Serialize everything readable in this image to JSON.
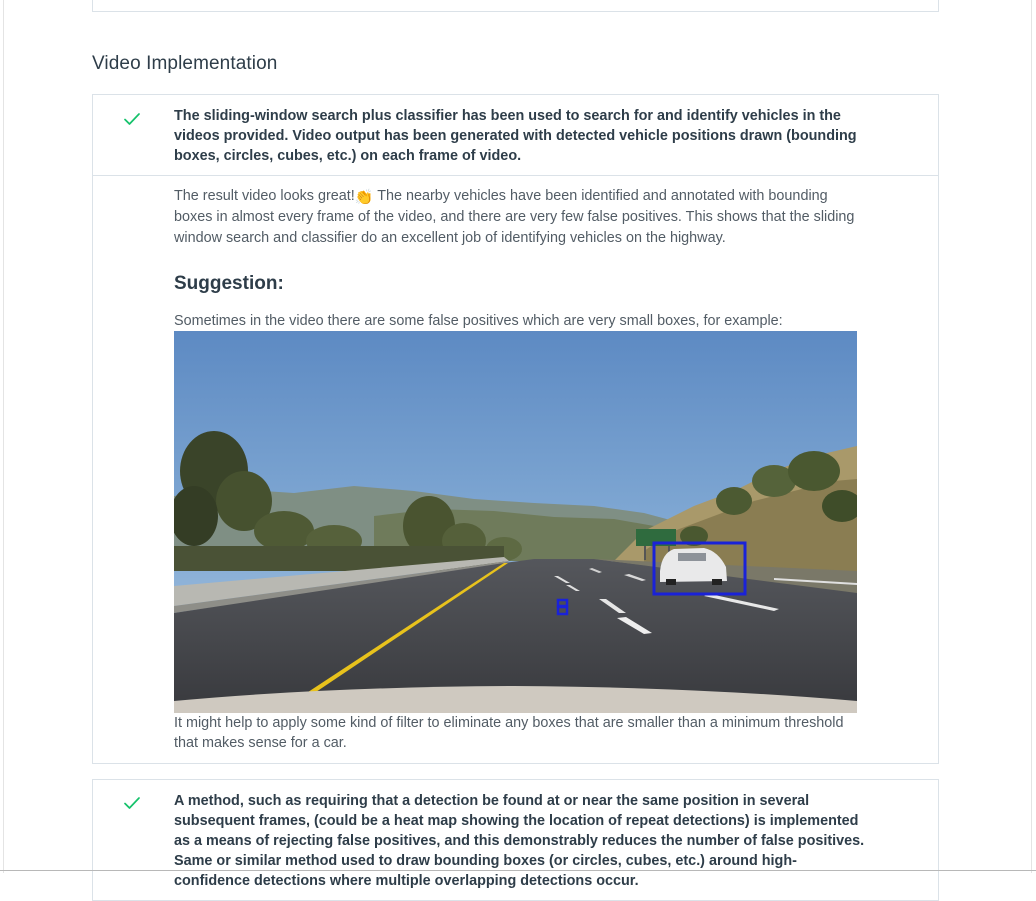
{
  "section": {
    "title": "Video Implementation"
  },
  "rubric_items": [
    {
      "status_icon": "checkmark-icon",
      "criteria": "The sliding-window search plus classifier has been used to search for and identify vehicles in the videos provided. Video output has been generated with detected vehicle positions drawn (bounding boxes, circles, cubes, etc.) on each frame of video.",
      "review": {
        "intro_part1": "The result video looks great!",
        "emoji": "👏",
        "intro_part2": " The nearby vehicles have been identified and annotated with bounding boxes in almost every frame of the video, and there are very few false positives. This shows that the sliding window search and classifier do an excellent job of identifying vehicles on the highway.",
        "suggestion_heading": "Suggestion:",
        "suggestion_text": "Sometimes in the video there are some false positives which are very small boxes, for example:",
        "image_name": "highway-frame-with-detections",
        "followup": "It might help to apply some kind of filter to eliminate any boxes that are smaller than a minimum threshold that makes sense for a car."
      }
    },
    {
      "status_icon": "checkmark-icon",
      "criteria": "A method, such as requiring that a detection be found at or near the same position in several subsequent frames, (could be a heat map showing the location of repeat detections) is implemented as a means of rejecting false positives, and this demonstrably reduces the number of false positives. Same or similar method used to draw bounding boxes (or circles, cubes, etc.) around high-confidence detections where multiple overlapping detections occur."
    }
  ],
  "colors": {
    "check_green": "#02b3e4",
    "detection_box": "#1a22d8",
    "card_border": "#dbe2e8"
  }
}
